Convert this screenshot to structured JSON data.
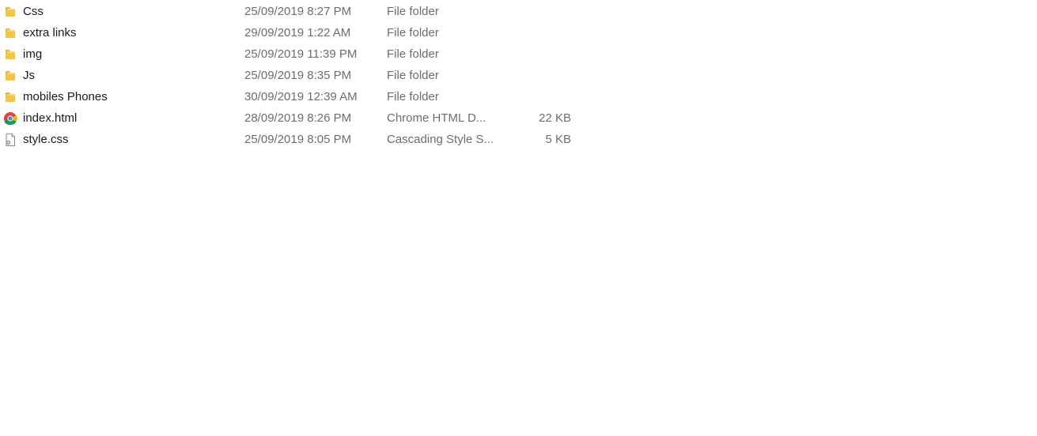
{
  "files": [
    {
      "name": "Css",
      "date": "25/09/2019 8:27 PM",
      "type": "File folder",
      "size": "",
      "icon": "folder-icon"
    },
    {
      "name": "extra links",
      "date": "29/09/2019 1:22 AM",
      "type": "File folder",
      "size": "",
      "icon": "folder-icon"
    },
    {
      "name": "img",
      "date": "25/09/2019 11:39 PM",
      "type": "File folder",
      "size": "",
      "icon": "folder-icon"
    },
    {
      "name": "Js",
      "date": "25/09/2019 8:35 PM",
      "type": "File folder",
      "size": "",
      "icon": "folder-icon"
    },
    {
      "name": "mobiles Phones",
      "date": "30/09/2019 12:39 AM",
      "type": "File folder",
      "size": "",
      "icon": "folder-icon"
    },
    {
      "name": "index.html",
      "date": "28/09/2019 8:26 PM",
      "type": "Chrome HTML D...",
      "size": "22 KB",
      "icon": "chrome-icon"
    },
    {
      "name": "style.css",
      "date": "25/09/2019 8:05 PM",
      "type": "Cascading Style S...",
      "size": "5 KB",
      "icon": "css-file-icon"
    }
  ],
  "colors": {
    "folder": "#f5c542",
    "secondary_text": "#6d6d6d",
    "primary_text": "#1a1a1a"
  }
}
